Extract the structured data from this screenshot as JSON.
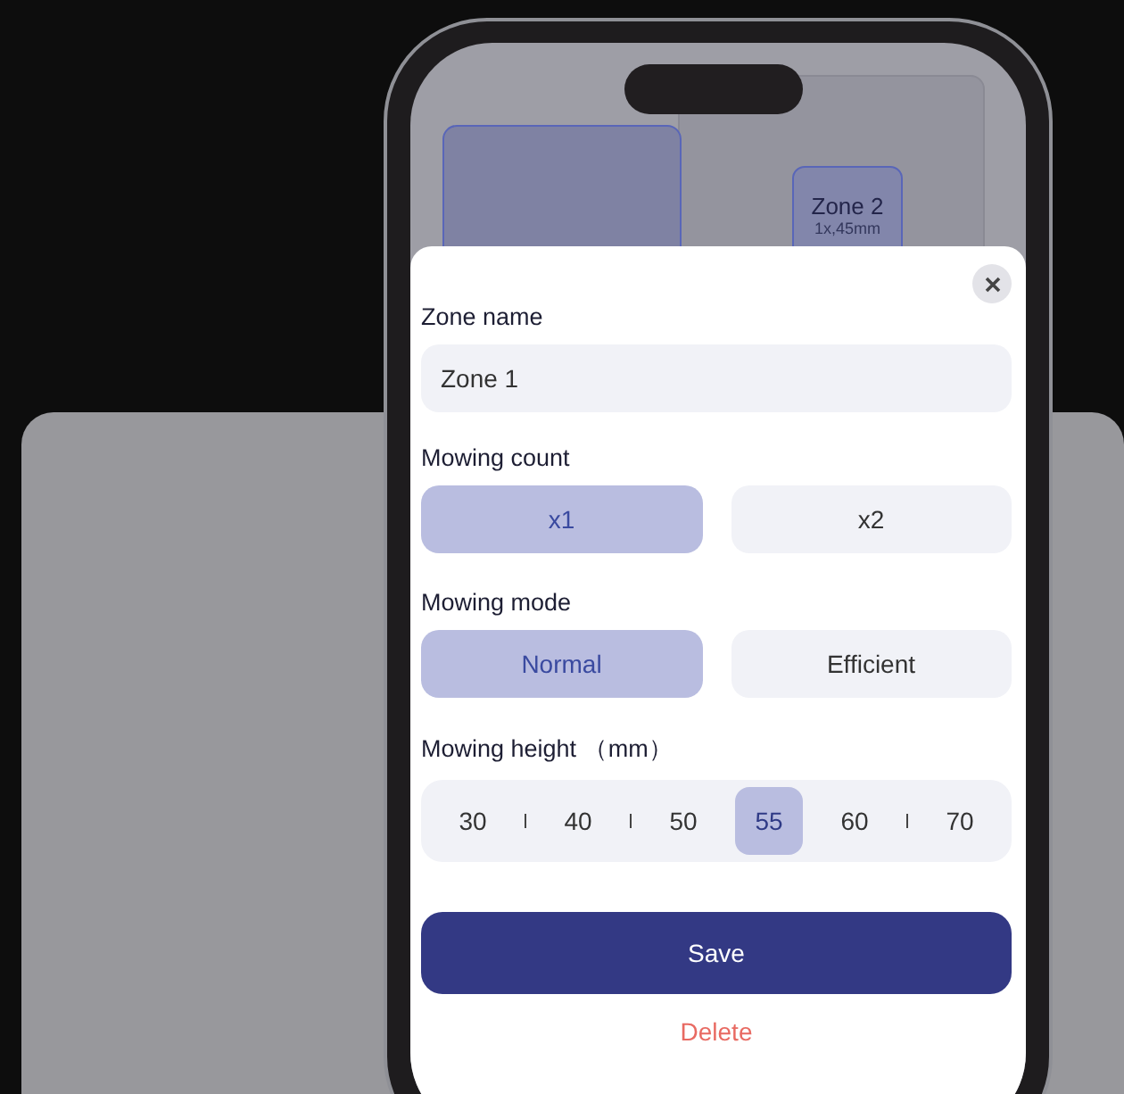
{
  "map": {
    "zones": [
      {
        "name": "Zone 2",
        "detail": "1x,45mm"
      }
    ]
  },
  "sheet": {
    "zone_name": {
      "label": "Zone name",
      "value": "Zone 1"
    },
    "mowing_count": {
      "label": "Mowing count",
      "options": [
        {
          "label": "x1",
          "selected": true
        },
        {
          "label": "x2",
          "selected": false
        }
      ]
    },
    "mowing_mode": {
      "label": "Mowing mode",
      "options": [
        {
          "label": "Normal",
          "selected": true
        },
        {
          "label": "Efficient",
          "selected": false
        }
      ]
    },
    "mowing_height": {
      "label": "Mowing height",
      "unit": "（mm）",
      "items": [
        {
          "kind": "value",
          "label": "30",
          "selected": false
        },
        {
          "kind": "tick"
        },
        {
          "kind": "value",
          "label": "40",
          "selected": false
        },
        {
          "kind": "tick"
        },
        {
          "kind": "value",
          "label": "50",
          "selected": false
        },
        {
          "kind": "value",
          "label": "55",
          "selected": true
        },
        {
          "kind": "value",
          "label": "60",
          "selected": false
        },
        {
          "kind": "tick"
        },
        {
          "kind": "value",
          "label": "70",
          "selected": false
        }
      ]
    },
    "save": "Save",
    "delete": "Delete"
  }
}
